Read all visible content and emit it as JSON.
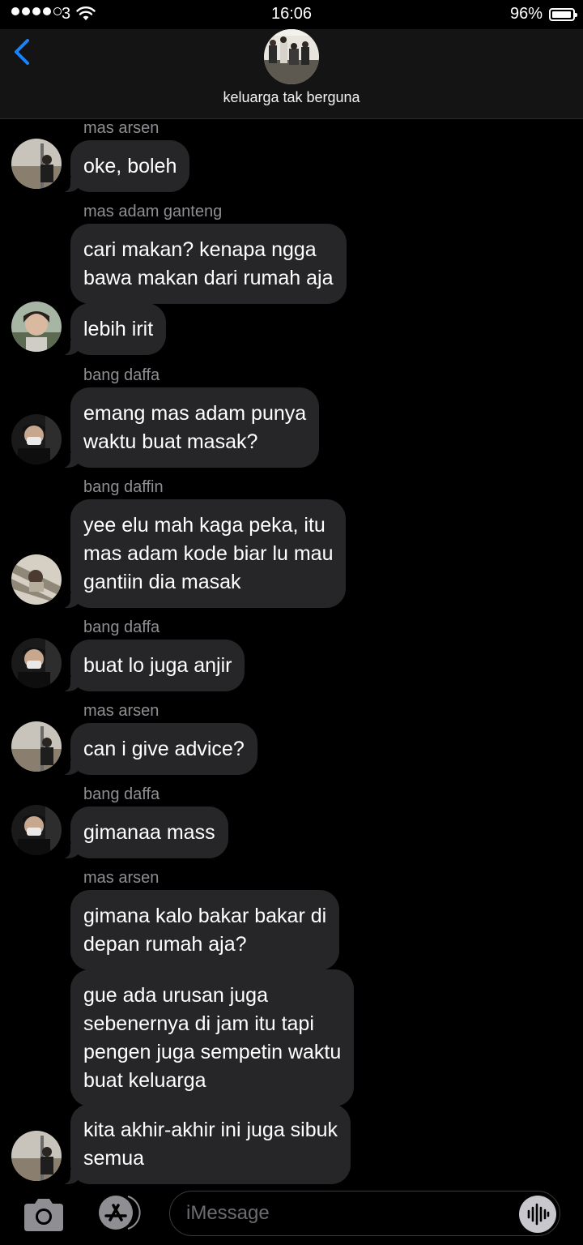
{
  "status_bar": {
    "carrier": "3",
    "time": "16:06",
    "battery_percent": "96%",
    "battery_level": 0.96,
    "signal_bars": 4,
    "signal_max": 5
  },
  "header": {
    "group_name": "keluarga tak berguna",
    "back_icon": "chevron-left-icon",
    "accent_color": "#1a82fb"
  },
  "messages": [
    {
      "sender": "mas arsen",
      "text": "oke, boleh"
    },
    {
      "sender": "mas adam ganteng",
      "text": "cari makan? kenapa ngga\nbawa makan dari rumah aja"
    },
    {
      "sender": "",
      "text": "lebih irit"
    },
    {
      "sender": "bang daffa",
      "text": "emang mas adam punya\nwaktu buat masak?"
    },
    {
      "sender": "bang daffin",
      "text": "yee elu mah kaga peka, itu\nmas adam kode biar lu mau\ngantiin dia masak"
    },
    {
      "sender": "bang daffa",
      "text": "buat lo juga anjir"
    },
    {
      "sender": "mas arsen",
      "text": "can i give advice?"
    },
    {
      "sender": "bang daffa",
      "text": "gimanaa mass"
    },
    {
      "sender": "mas arsen",
      "text": "gimana kalo bakar bakar di\ndepan rumah aja?"
    },
    {
      "sender": "",
      "text": "gue ada urusan juga\nsebenernya di jam itu tapi\npengen juga sempetin waktu\nbuat keluarga"
    },
    {
      "sender": "",
      "text": "kita akhir-akhir ini juga sibuk\nsemua"
    }
  ],
  "input_bar": {
    "placeholder": "iMessage",
    "camera_icon": "camera-icon",
    "apps_icon": "app-store-icon",
    "audio_icon": "audio-waveform-icon"
  }
}
